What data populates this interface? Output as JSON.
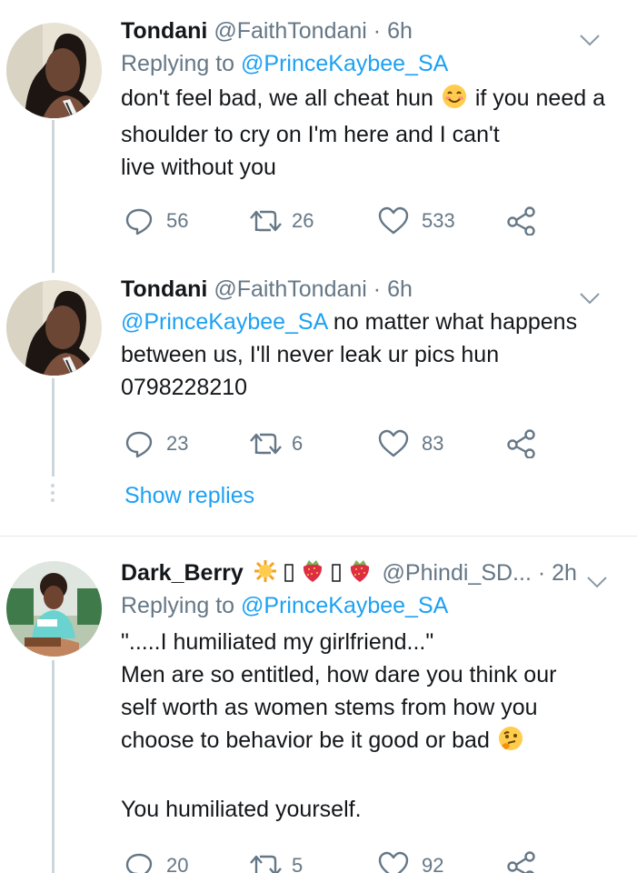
{
  "tweets": [
    {
      "name": "Tondani",
      "handle": "@FaithTondani",
      "time": "· 6h",
      "replying_label": "Replying to",
      "replying_to": "@PrinceKaybee_SA",
      "text_lines": [
        "don't feel bad, we all cheat hun",
        "if you need a shoulder to cry on I'm here and I can't",
        "live without you"
      ],
      "replies": "56",
      "retweets": "26",
      "likes": "533"
    },
    {
      "name": "Tondani",
      "handle": "@FaithTondani",
      "time": "· 6h",
      "mention": "@PrinceKaybee_SA",
      "text_lines": [
        "no matter what happens",
        "between us, I'll never leak ur pics hun",
        "0798228210"
      ],
      "replies": "23",
      "retweets": "6",
      "likes": "83"
    },
    {
      "name": "Dark_Berry",
      "handle": "@Phindi_SD...",
      "time": "· 2h",
      "replying_label": "Replying to",
      "replying_to": "@PrinceKaybee_SA",
      "text_lines": [
        "\".....I humiliated my girlfriend...\"",
        "Men are so entitled,  how dare you think our",
        "self worth as women stems from how you",
        "choose to behavior be it good or bad",
        "You humiliated yourself."
      ],
      "replies": "20",
      "retweets": "5",
      "likes": "92"
    }
  ],
  "show_replies": "Show replies",
  "icons": {
    "reply": "reply-icon",
    "retweet": "retweet-icon",
    "like": "heart-icon",
    "share": "share-icon",
    "more": "chevron-down-icon",
    "smile": "smiling-face-emoji",
    "thinking": "thinking-face-emoji",
    "sun": "sun-emoji",
    "strawberry": "strawberry-emoji"
  },
  "colors": {
    "link": "#1da1f2",
    "muted": "#657786",
    "thread_line": "#cdd6dd"
  }
}
